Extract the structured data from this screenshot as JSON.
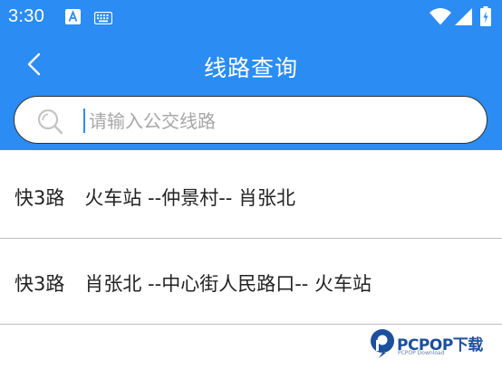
{
  "status_bar": {
    "time": "3:30",
    "icons": [
      "a-notification-icon",
      "keyboard-icon",
      "wifi-icon",
      "signal-icon",
      "battery-charging-icon"
    ]
  },
  "header": {
    "title": "线路查询",
    "back_icon": "chevron-left-icon"
  },
  "search": {
    "placeholder": "请输入公交线路",
    "value": ""
  },
  "routes": [
    {
      "number": "快3路",
      "line": "火车站 --仲景村-- 肖张北"
    },
    {
      "number": "快3路",
      "line": "肖张北 --中心街人民路口-- 火车站"
    }
  ],
  "watermark": {
    "name": "PCPOP下载",
    "sub": "PCPOP Download"
  },
  "colors": {
    "header_bg": "#2b8cf3",
    "caret": "#2b8cf3",
    "divider": "#bdbdbd",
    "text": "#222222"
  }
}
